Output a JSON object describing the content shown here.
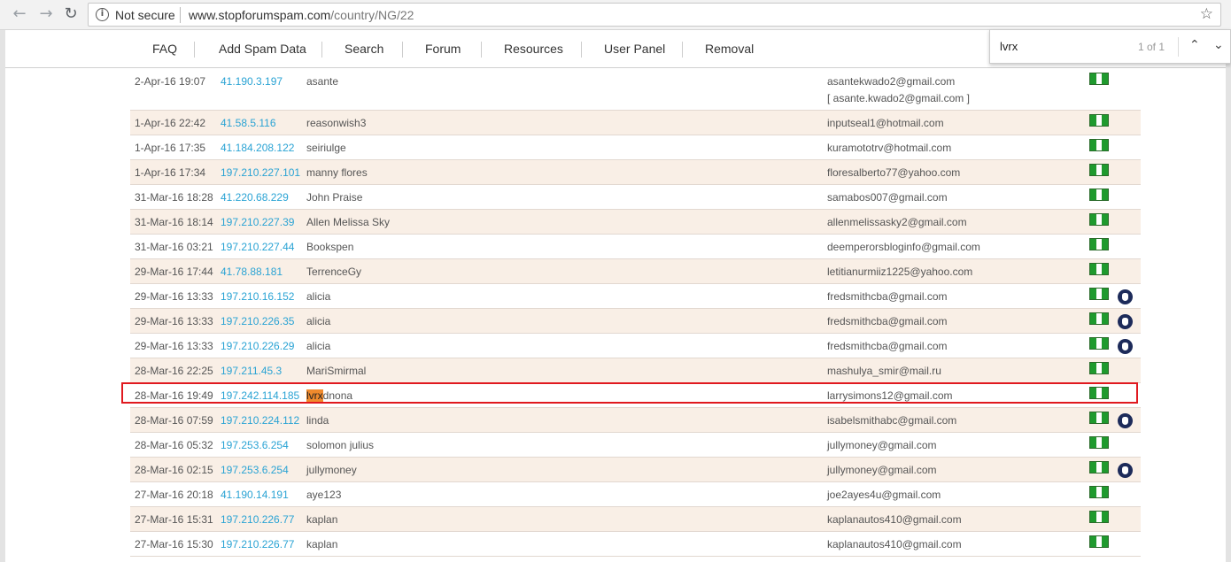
{
  "browser": {
    "back_icon": "back-arrow-icon",
    "forward_icon": "forward-arrow-icon",
    "reload_icon": "reload-icon",
    "security_label": "Not secure",
    "url_host": "www.stopforumspam.com",
    "url_path": "/country/NG/22"
  },
  "nav": {
    "items": [
      "FAQ",
      "Add Spam Data",
      "Search",
      "Forum",
      "Resources",
      "User Panel",
      "Removal"
    ]
  },
  "find": {
    "query": "lvrx",
    "count": "1 of 1"
  },
  "rows": [
    {
      "date": "2-Apr-16 19:07",
      "ip": "41.190.3.197",
      "user": "asante",
      "email": "asantekwado2@gmail.com",
      "email2": "[ asante.kwado2@gmail.com ]",
      "tor": false
    },
    {
      "date": "1-Apr-16 22:42",
      "ip": "41.58.5.116",
      "user": "reasonwish3",
      "email": "inputseal1@hotmail.com",
      "tor": false
    },
    {
      "date": "1-Apr-16 17:35",
      "ip": "41.184.208.122",
      "user": "seiriulge",
      "email": "kuramototrv@hotmail.com",
      "tor": false
    },
    {
      "date": "1-Apr-16 17:34",
      "ip": "197.210.227.101",
      "user": "manny flores",
      "email": "floresalberto77@yahoo.com",
      "tor": false
    },
    {
      "date": "31-Mar-16 18:28",
      "ip": "41.220.68.229",
      "user": "John Praise",
      "email": "samabos007@gmail.com",
      "tor": false
    },
    {
      "date": "31-Mar-16 18:14",
      "ip": "197.210.227.39",
      "user": "Allen Melissa Sky",
      "email": "allenmelissasky2@gmail.com",
      "tor": false
    },
    {
      "date": "31-Mar-16 03:21",
      "ip": "197.210.227.44",
      "user": "Bookspen",
      "email": "deemperorsbloginfo@gmail.com",
      "tor": false
    },
    {
      "date": "29-Mar-16 17:44",
      "ip": "41.78.88.181",
      "user": "TerrenceGy",
      "email": "letitianurmiiz1225@yahoo.com",
      "tor": false
    },
    {
      "date": "29-Mar-16 13:33",
      "ip": "197.210.16.152",
      "user": "alicia",
      "email": "fredsmithcba@gmail.com",
      "tor": true
    },
    {
      "date": "29-Mar-16 13:33",
      "ip": "197.210.226.35",
      "user": "alicia",
      "email": "fredsmithcba@gmail.com",
      "tor": true
    },
    {
      "date": "29-Mar-16 13:33",
      "ip": "197.210.226.29",
      "user": "alicia",
      "email": "fredsmithcba@gmail.com",
      "tor": true
    },
    {
      "date": "28-Mar-16 22:25",
      "ip": "197.211.45.3",
      "user": "MariSmirmal",
      "email": "mashulya_smir@mail.ru",
      "tor": false
    },
    {
      "date": "28-Mar-16 19:49",
      "ip": "197.242.114.185",
      "user_hl": "lvrx",
      "user_rest": "dnona",
      "email": "larrysimons12@gmail.com",
      "tor": false
    },
    {
      "date": "28-Mar-16 07:59",
      "ip": "197.210.224.112",
      "user": "linda",
      "email": "isabelsmithabc@gmail.com",
      "tor": true
    },
    {
      "date": "28-Mar-16 05:32",
      "ip": "197.253.6.254",
      "user": "solomon julius",
      "email": "jullymoney@gmail.com",
      "tor": false
    },
    {
      "date": "28-Mar-16 02:15",
      "ip": "197.253.6.254",
      "user": "jullymoney",
      "email": "jullymoney@gmail.com",
      "tor": true
    },
    {
      "date": "27-Mar-16 20:18",
      "ip": "41.190.14.191",
      "user": "aye123",
      "email": "joe2ayes4u@gmail.com",
      "tor": false
    },
    {
      "date": "27-Mar-16 15:31",
      "ip": "197.210.226.77",
      "user": "kaplan",
      "email": "kaplanautos410@gmail.com",
      "tor": false
    },
    {
      "date": "27-Mar-16 15:30",
      "ip": "197.210.226.77",
      "user": "kaplan",
      "email": "kaplanautos410@gmail.com",
      "tor": false
    }
  ]
}
